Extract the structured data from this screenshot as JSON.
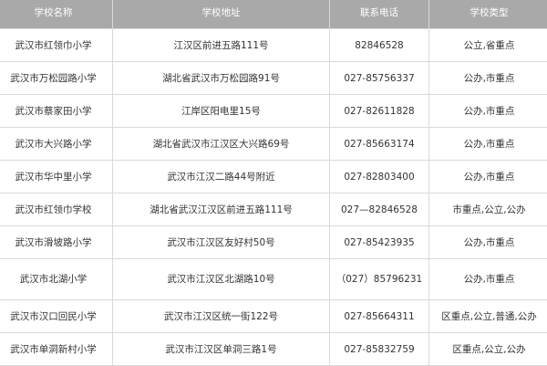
{
  "headers": [
    "学校名称",
    "学校地址",
    "联系电话",
    "学校类型"
  ],
  "rows": [
    {
      "name": "武汉市红领巾小学",
      "address": "江汉区前进五路111号",
      "phone": "82846528",
      "type": "公立,省重点"
    },
    {
      "name": "武汉市万松园路小学",
      "address": "湖北省武汉市万松园路91号",
      "phone": "027-85756337",
      "type": "公办,市重点"
    },
    {
      "name": "武汉市蔡家田小学",
      "address": "江岸区阳电里15号",
      "phone": "027-82611828",
      "type": "公办,市重点"
    },
    {
      "name": "武汉市大兴路小学",
      "address": "湖北省武汉市江汉区大兴路69号",
      "phone": "027-85663174",
      "type": "公办,市重点"
    },
    {
      "name": "武汉市华中里小学",
      "address": "武汉市江汉二路44号附近",
      "phone": "027-82803400",
      "type": "公办,市重点"
    },
    {
      "name": "武汉市红领巾学校",
      "address": "湖北省武汉江汉区前进五路111号",
      "phone": "027—82846528",
      "type": "市重点,公立,公办"
    },
    {
      "name": "武汉市滑坡路小学",
      "address": "武汉市江汉区友好村50号",
      "phone": "027-85423935",
      "type": "公办,市重点"
    },
    {
      "name": "武汉市北湖小学",
      "address": "武汉市江汉区北湖路10号",
      "phone": "（027）85796231",
      "type": "公办,市重点"
    },
    {
      "name": "武汉市汉口回民小学",
      "address": "武汉市江汉区统一街122号",
      "phone": "027-85664311",
      "type": "区重点,公立,普通,公办"
    },
    {
      "name": "武汉市单洞新村小学",
      "address": "武汉市江汉区单洞三路1号",
      "phone": "027-85832759",
      "type": "区重点,公立,公办"
    }
  ]
}
